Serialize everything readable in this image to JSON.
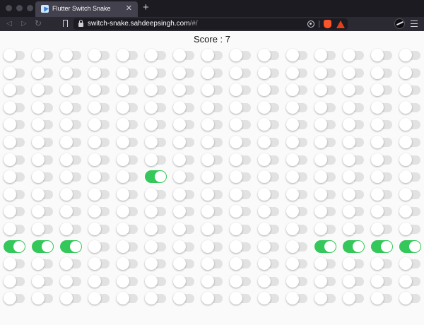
{
  "browser": {
    "tab_title": "Flutter Switch Snake",
    "tab_close_glyph": "✕",
    "new_tab_glyph": "+",
    "url_host": "switch-snake.sahdeepsingh.com",
    "url_path": "/#/",
    "nav": {
      "back_glyph": "◁",
      "forward_glyph": "▷",
      "reload_glyph": "↻"
    }
  },
  "game": {
    "score_label": "Score : 7",
    "rows": 15,
    "cols": 15,
    "on_color": "#34c759",
    "off_color": "#e2e2e2",
    "on_cells": [
      [
        7,
        5
      ],
      [
        11,
        0
      ],
      [
        11,
        1
      ],
      [
        11,
        2
      ],
      [
        11,
        11
      ],
      [
        11,
        12
      ],
      [
        11,
        13
      ],
      [
        11,
        14
      ]
    ]
  }
}
